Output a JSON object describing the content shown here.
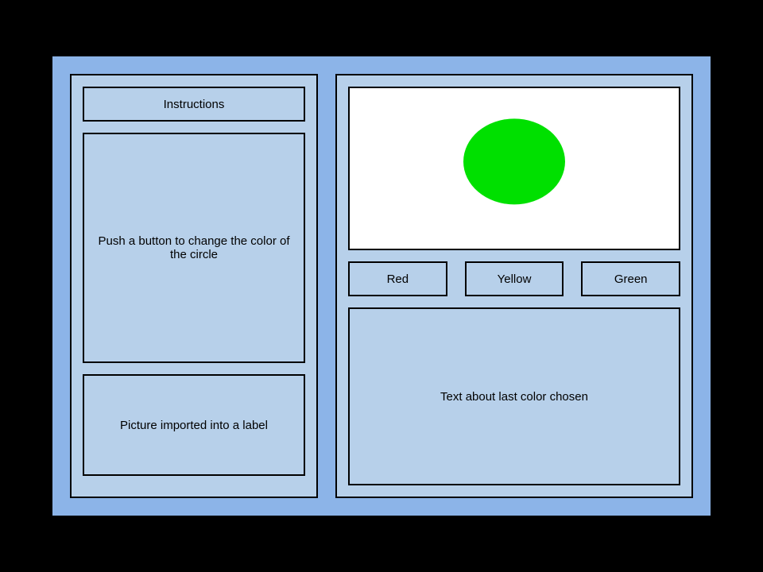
{
  "left": {
    "instructions_header": "Instructions",
    "instructions_body": "Push a button to change the color of the circle",
    "picture_label": "Picture imported into a label"
  },
  "right": {
    "circle_color": "#00e000",
    "buttons": {
      "red": "Red",
      "yellow": "Yellow",
      "green": "Green"
    },
    "status_text": "Text about last color chosen"
  }
}
